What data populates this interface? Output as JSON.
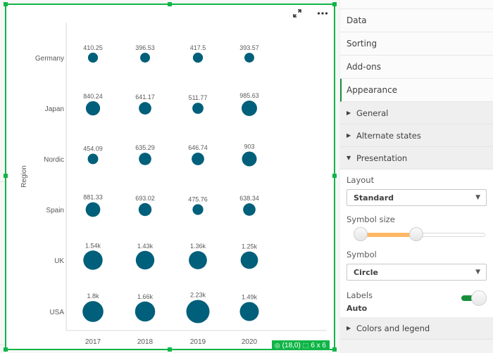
{
  "chart_toolbar": {
    "expand_icon": "expand-arrows-icon",
    "more_icon": "more-horizontal-icon"
  },
  "status_badge": {
    "position_icon": "target-icon",
    "position": "(18,0)",
    "size_icon": "grid-size-icon",
    "size": "6 x 6"
  },
  "chart_data": {
    "type": "scatter",
    "subtype": "grid-bubble",
    "title": "",
    "xlabel": "",
    "ylabel": "Region",
    "categories_x": [
      "2017",
      "2018",
      "2019",
      "2020",
      "-"
    ],
    "categories_y": [
      "Germany",
      "Japan",
      "Nordic",
      "Spain",
      "UK",
      "USA"
    ],
    "color": "#005f7a",
    "grid": false,
    "points": [
      {
        "region": "Germany",
        "year": "2017",
        "value": 410.25,
        "label": "410.25"
      },
      {
        "region": "Germany",
        "year": "2018",
        "value": 396.53,
        "label": "396.53"
      },
      {
        "region": "Germany",
        "year": "2019",
        "value": 417.5,
        "label": "417.5"
      },
      {
        "region": "Germany",
        "year": "2020",
        "value": 393.57,
        "label": "393.57"
      },
      {
        "region": "Japan",
        "year": "2017",
        "value": 840.24,
        "label": "840.24"
      },
      {
        "region": "Japan",
        "year": "2018",
        "value": 641.17,
        "label": "641.17"
      },
      {
        "region": "Japan",
        "year": "2019",
        "value": 511.77,
        "label": "511.77"
      },
      {
        "region": "Japan",
        "year": "2020",
        "value": 985.63,
        "label": "985.63"
      },
      {
        "region": "Nordic",
        "year": "2017",
        "value": 454.09,
        "label": "454.09"
      },
      {
        "region": "Nordic",
        "year": "2018",
        "value": 635.29,
        "label": "635.29"
      },
      {
        "region": "Nordic",
        "year": "2019",
        "value": 646.74,
        "label": "646.74"
      },
      {
        "region": "Nordic",
        "year": "2020",
        "value": 903,
        "label": "903"
      },
      {
        "region": "Spain",
        "year": "2017",
        "value": 881.33,
        "label": "881.33"
      },
      {
        "region": "Spain",
        "year": "2018",
        "value": 693.02,
        "label": "693.02"
      },
      {
        "region": "Spain",
        "year": "2019",
        "value": 475.76,
        "label": "475.76"
      },
      {
        "region": "Spain",
        "year": "2020",
        "value": 638.34,
        "label": "638.34"
      },
      {
        "region": "UK",
        "year": "2017",
        "value": 1540,
        "label": "1.54k"
      },
      {
        "region": "UK",
        "year": "2018",
        "value": 1430,
        "label": "1.43k"
      },
      {
        "region": "UK",
        "year": "2019",
        "value": 1360,
        "label": "1.36k"
      },
      {
        "region": "UK",
        "year": "2020",
        "value": 1250,
        "label": "1.25k"
      },
      {
        "region": "USA",
        "year": "2017",
        "value": 1800,
        "label": "1.8k"
      },
      {
        "region": "USA",
        "year": "2018",
        "value": 1660,
        "label": "1.66k"
      },
      {
        "region": "USA",
        "year": "2019",
        "value": 2230,
        "label": "2.23k"
      },
      {
        "region": "USA",
        "year": "2020",
        "value": 1490,
        "label": "1.49k"
      }
    ]
  },
  "panel": {
    "tabs": [
      {
        "label": "Data",
        "active": false
      },
      {
        "label": "Sorting",
        "active": false
      },
      {
        "label": "Add-ons",
        "active": false
      },
      {
        "label": "Appearance",
        "active": true
      }
    ],
    "sections": {
      "general": {
        "label": "General",
        "expanded": false
      },
      "alternate_states": {
        "label": "Alternate states",
        "expanded": false
      },
      "presentation": {
        "label": "Presentation",
        "expanded": true
      },
      "colors_legend": {
        "label": "Colors and legend",
        "expanded": false
      }
    },
    "presentation": {
      "layout_label": "Layout",
      "layout_value": "Standard",
      "symbol_size_label": "Symbol size",
      "symbol_size_range": {
        "min": 0.0,
        "max": 0.47
      },
      "symbol_label": "Symbol",
      "symbol_value": "Circle",
      "labels_label": "Labels",
      "labels_value": "Auto",
      "labels_toggle_on": true
    },
    "colors": {
      "accent": "#168f3d",
      "slider_fill": "#ffb866",
      "selection": "#10b547"
    }
  }
}
